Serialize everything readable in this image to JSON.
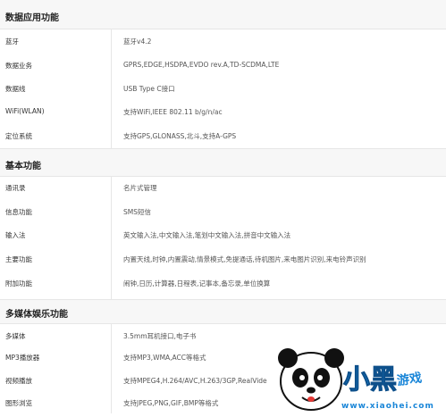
{
  "sections": [
    {
      "title": "数据应用功能",
      "rows": [
        {
          "label": "蓝牙",
          "value": "蓝牙v4.2"
        },
        {
          "label": "数据业务",
          "value": "GPRS,EDGE,HSDPA,EVDO rev.A,TD-SCDMA,LTE"
        },
        {
          "label": "数据线",
          "value": "USB Type C接口"
        },
        {
          "label": "WiFi(WLAN)",
          "value": "支持WiFi,IEEE 802.11 b/g/n/ac"
        },
        {
          "label": "定位系统",
          "value": "支持GPS,GLONASS,北斗,支持A-GPS"
        }
      ]
    },
    {
      "title": "基本功能",
      "rows": [
        {
          "label": "通讯录",
          "value": "名片式管理"
        },
        {
          "label": "信息功能",
          "value": "SMS短信"
        },
        {
          "label": "输入法",
          "value": "英文输入法,中文输入法,笔划中文输入法,拼音中文输入法"
        },
        {
          "label": "主要功能",
          "value": "内置天线,时钟,内置震动,情景模式,免提通话,待机图片,来电图片识别,来电铃声识别"
        },
        {
          "label": "附加功能",
          "value": "闹钟,日历,计算器,日程表,记事本,备忘录,单位换算"
        }
      ]
    },
    {
      "title": "多媒体娱乐功能",
      "rows": [
        {
          "label": "多媒体",
          "value": "3.5mm耳机接口,电子书"
        },
        {
          "label": "MP3播放器",
          "value": "支持MP3,WMA,ACC等格式"
        },
        {
          "label": "视频播放",
          "value": "支持MPEG4,H.264/AVC,H.263/3GP,RealVide"
        },
        {
          "label": "图形浏览",
          "value": "支持JPEG,PNG,GIF,BMP等格式"
        }
      ]
    }
  ],
  "watermark": {
    "brand": "小黑游戏",
    "url": "www.xiaohei.com"
  },
  "colors": {
    "header_bg": "#f7f7f7",
    "border": "#e6e6e6",
    "brand_blue": "#1a86d8"
  }
}
